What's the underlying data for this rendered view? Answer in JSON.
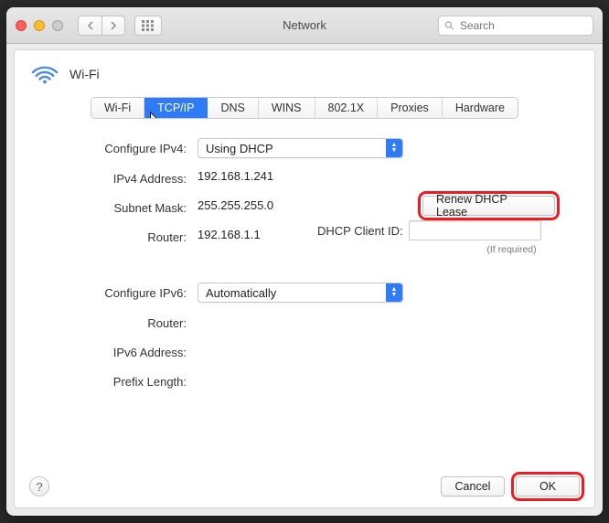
{
  "window": {
    "title": "Network",
    "search_placeholder": "Search"
  },
  "interface": {
    "name": "Wi-Fi"
  },
  "tabs": {
    "wifi": "Wi-Fi",
    "tcpip": "TCP/IP",
    "dns": "DNS",
    "wins": "WINS",
    "dot1x": "802.1X",
    "proxies": "Proxies",
    "hardware": "Hardware"
  },
  "form": {
    "configure_v4_label": "Configure IPv4:",
    "configure_v4_value": "Using DHCP",
    "ipv4_addr_label": "IPv4 Address:",
    "ipv4_addr_value": "192.168.1.241",
    "subnet_label": "Subnet Mask:",
    "subnet_value": "255.255.255.0",
    "router4_label": "Router:",
    "router4_value": "192.168.1.1",
    "renew_label": "Renew DHCP Lease",
    "client_id_label": "DHCP Client ID:",
    "client_id_value": "",
    "client_id_required": "(If required)",
    "configure_v6_label": "Configure IPv6:",
    "configure_v6_value": "Automatically",
    "router6_label": "Router:",
    "router6_value": "",
    "ipv6_addr_label": "IPv6 Address:",
    "ipv6_addr_value": "",
    "prefix_label": "Prefix Length:",
    "prefix_value": ""
  },
  "footer": {
    "help": "?",
    "cancel": "Cancel",
    "ok": "OK"
  }
}
